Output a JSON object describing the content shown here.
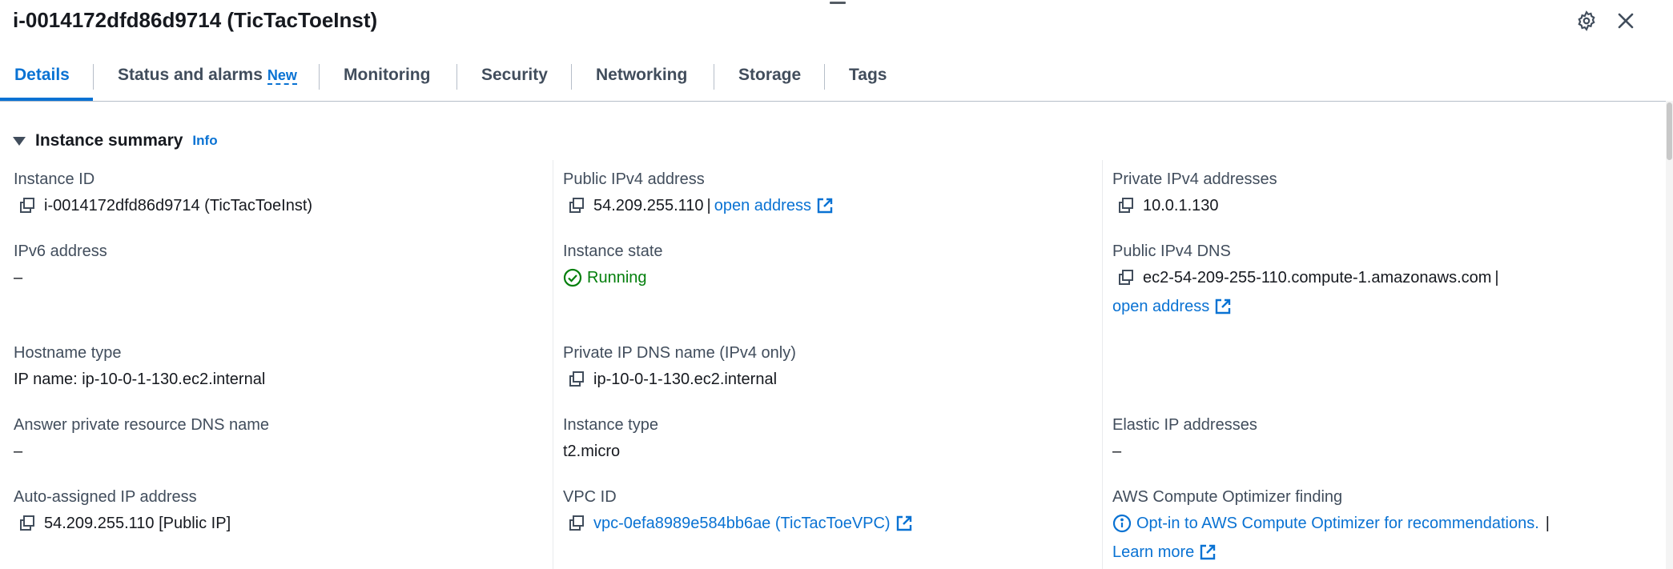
{
  "header": {
    "title": "i-0014172dfd86d9714 (TicTacToeInst)"
  },
  "tabs": [
    {
      "label": "Details",
      "active": true
    },
    {
      "label": "Status and alarms",
      "badge": "New"
    },
    {
      "label": "Monitoring"
    },
    {
      "label": "Security"
    },
    {
      "label": "Networking"
    },
    {
      "label": "Storage"
    },
    {
      "label": "Tags"
    }
  ],
  "section": {
    "title": "Instance summary",
    "info": "Info"
  },
  "fields": {
    "instance_id": {
      "label": "Instance ID",
      "value": "i-0014172dfd86d9714 (TicTacToeInst)"
    },
    "public_ipv4": {
      "label": "Public IPv4 address",
      "value": "54.209.255.110",
      "link": "open address"
    },
    "private_ipv4": {
      "label": "Private IPv4 addresses",
      "value": "10.0.1.130"
    },
    "ipv6": {
      "label": "IPv6 address",
      "value": "–"
    },
    "instance_state": {
      "label": "Instance state",
      "value": "Running"
    },
    "public_dns": {
      "label": "Public IPv4 DNS",
      "value": "ec2-54-209-255-110.compute-1.amazonaws.com",
      "link": "open address"
    },
    "hostname_type": {
      "label": "Hostname type",
      "value": "IP name: ip-10-0-1-130.ec2.internal"
    },
    "private_dns": {
      "label": "Private IP DNS name (IPv4 only)",
      "value": "ip-10-0-1-130.ec2.internal"
    },
    "answer_dns": {
      "label": "Answer private resource DNS name",
      "value": "–"
    },
    "instance_type": {
      "label": "Instance type",
      "value": "t2.micro"
    },
    "elastic_ip": {
      "label": "Elastic IP addresses",
      "value": "–"
    },
    "auto_ip": {
      "label": "Auto-assigned IP address",
      "value": "54.209.255.110 [Public IP]"
    },
    "vpc_id": {
      "label": "VPC ID",
      "value": "vpc-0efa8989e584bb6ae (TicTacToeVPC)"
    },
    "optimizer": {
      "label": "AWS Compute Optimizer finding",
      "value": "Opt-in to AWS Compute Optimizer for recommendations.",
      "link": "Learn more"
    }
  },
  "colors": {
    "link": "#0972d3",
    "success": "#037f0c",
    "text": "#16191f",
    "label": "#414d5c"
  }
}
